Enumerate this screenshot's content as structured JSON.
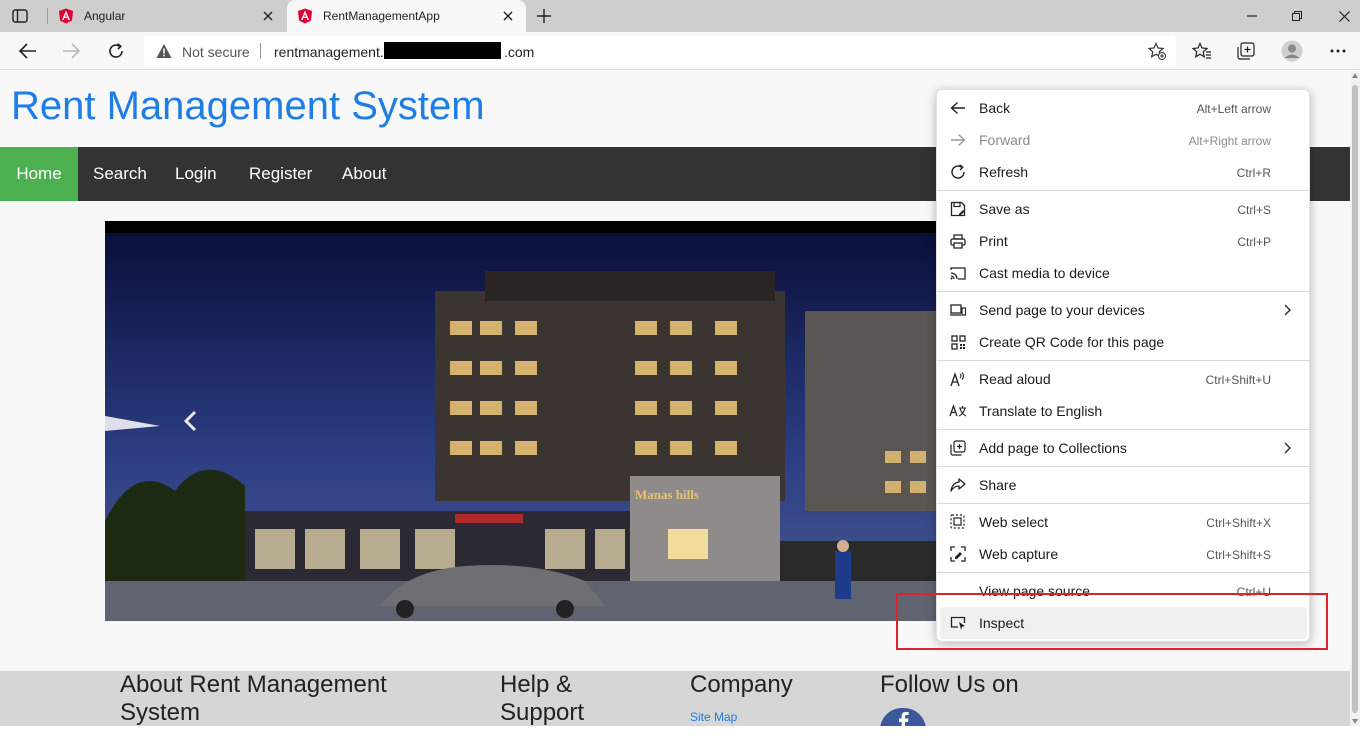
{
  "browser": {
    "tabs": [
      {
        "title": "Angular",
        "active": false,
        "favicon": "angular-icon"
      },
      {
        "title": "RentManagementApp",
        "active": true,
        "favicon": "angular-icon"
      }
    ],
    "address": {
      "security_label": "Not secure",
      "url_host": "rentmanagement.",
      "url_tld": ".com"
    }
  },
  "site": {
    "title": "Rent Management System",
    "nav": [
      "Home",
      "Search",
      "Login",
      "Register",
      "About"
    ],
    "banner_sign": "Manas hills",
    "footer": {
      "about_line1": "About Rent Management",
      "about_line2": "System",
      "help_line1": "Help &",
      "help_line2": "Support",
      "company": "Company",
      "company_link": "Site Map",
      "follow": "Follow Us on"
    }
  },
  "context_menu": {
    "items": [
      {
        "label": "Back",
        "shortcut": "Alt+Left arrow",
        "icon": "arrow-left-icon"
      },
      {
        "label": "Forward",
        "shortcut": "Alt+Right arrow",
        "icon": "arrow-right-icon",
        "disabled": true
      },
      {
        "label": "Refresh",
        "shortcut": "Ctrl+R",
        "icon": "refresh-icon"
      },
      {
        "label": "Save as",
        "shortcut": "Ctrl+S",
        "icon": "save-icon"
      },
      {
        "label": "Print",
        "shortcut": "Ctrl+P",
        "icon": "print-icon"
      },
      {
        "label": "Cast media to device",
        "shortcut": "",
        "icon": "cast-icon"
      },
      {
        "label": "Send page to your devices",
        "shortcut": "",
        "icon": "devices-icon",
        "submenu": true
      },
      {
        "label": "Create QR Code for this page",
        "shortcut": "",
        "icon": "qr-code-icon"
      },
      {
        "label": "Read aloud",
        "shortcut": "Ctrl+Shift+U",
        "icon": "read-aloud-icon"
      },
      {
        "label": "Translate to English",
        "shortcut": "",
        "icon": "translate-icon"
      },
      {
        "label": "Add page to Collections",
        "shortcut": "",
        "icon": "collections-icon",
        "submenu": true
      },
      {
        "label": "Share",
        "shortcut": "",
        "icon": "share-icon"
      },
      {
        "label": "Web select",
        "shortcut": "Ctrl+Shift+X",
        "icon": "web-select-icon"
      },
      {
        "label": "Web capture",
        "shortcut": "Ctrl+Shift+S",
        "icon": "web-capture-icon"
      },
      {
        "label": "View page source",
        "shortcut": "Ctrl+U",
        "icon": ""
      },
      {
        "label": "Inspect",
        "shortcut": "",
        "icon": "inspect-icon",
        "highlighted": true
      }
    ]
  },
  "colors": {
    "title_blue": "#1e7ee6",
    "nav_bg": "#333333",
    "nav_active": "#4caf50",
    "highlight_box": "#e0212a"
  }
}
